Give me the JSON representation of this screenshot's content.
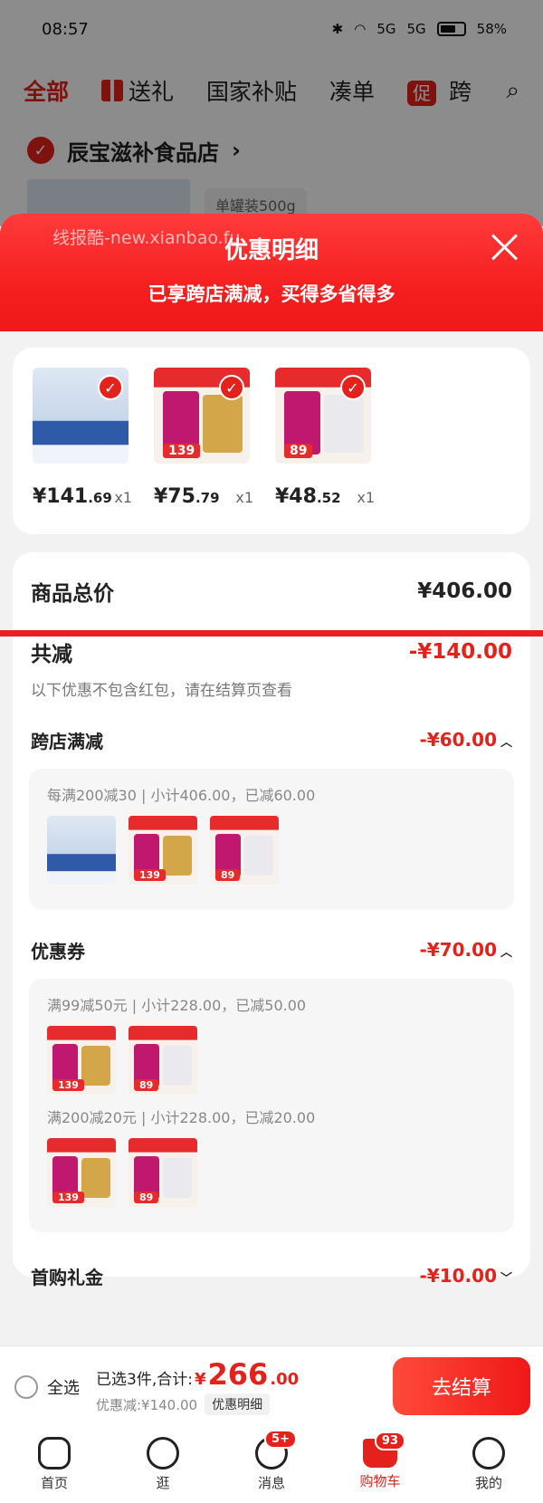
{
  "status_bar": {
    "time": "08:57",
    "signal_1": "5G",
    "signal_2": "5G",
    "battery": "58%"
  },
  "top_tabs": {
    "all": "全部",
    "gift": "送礼",
    "subsidy": "国家补贴",
    "bundle": "凑单",
    "promo_badge": "促",
    "cross": "跨"
  },
  "store": {
    "name": "辰宝滋补食品店",
    "chevron": "›",
    "spec": "单罐装500g"
  },
  "modal": {
    "watermark": "线报酷-new.xianbao.fu",
    "title": "优惠明细",
    "subtitle": "已享跨店满减，买得多省得多"
  },
  "items": [
    {
      "price_int": "¥141",
      "price_dec": ".69",
      "qty": "x1"
    },
    {
      "price_int": "¥75",
      "price_dec": ".79",
      "qty": "x1"
    },
    {
      "price_int": "¥48",
      "price_dec": ".52",
      "qty": "x1"
    }
  ],
  "product_tags": {
    "p2_price": "139",
    "p3_price": "89"
  },
  "totals": {
    "goods_label": "商品总价",
    "goods_value": "¥406.00",
    "discount_label": "共减",
    "discount_value": "-¥140.00",
    "note": "以下优惠不包含红包，请在结算页查看"
  },
  "sections": {
    "cross_store": {
      "label": "跨店满减",
      "value": "-¥60.00",
      "caret": "︿",
      "rule": "每满200减30 | 小计406.00，已减60.00"
    },
    "coupon": {
      "label": "优惠券",
      "value": "-¥70.00",
      "caret": "︿",
      "rule1": "满99减50元 | 小计228.00，已减50.00",
      "rule2": "满200减20元 | 小计228.00，已减20.00"
    },
    "first_buy": {
      "label": "首购礼金",
      "value": "-¥10.00",
      "caret": "﹀"
    }
  },
  "checkout": {
    "select_all": "全选",
    "selected_text": "已选3件,合计:",
    "currency": "¥",
    "total_int": "266",
    "total_dec": ".00",
    "discount_text": "优惠减:¥140.00",
    "detail_chip": "优惠明细",
    "button": "去结算"
  },
  "bottom_nav": {
    "home": "首页",
    "browse": "逛",
    "messages": "消息",
    "messages_badge": "5+",
    "cart": "购物车",
    "cart_badge": "93",
    "me": "我的"
  },
  "colors": {
    "accent": "#e4211b",
    "header_red": "#f52020"
  }
}
